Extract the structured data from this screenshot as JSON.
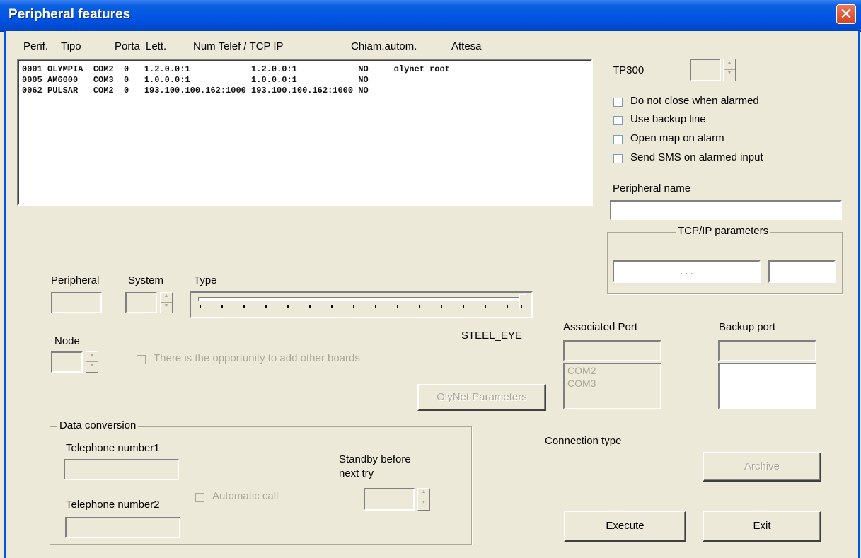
{
  "window": {
    "title": "Peripheral features",
    "close_icon": "close-icon"
  },
  "list": {
    "headers": [
      "Perif.",
      "Tipo",
      "Porta",
      "Lett.",
      "Num Telef / TCP IP",
      "Chiam.autom.",
      "Attesa"
    ],
    "rows": [
      "0001 OLYMPIA  COM2  0   1.2.0.0:1            1.2.0.0:1            NO     olynet root",
      "0005 AM6000   COM3  0   1.0.0.0:1            1.0.0.0:1            NO",
      "0062 PULSAR   COM2  0   193.100.100.162:1000 193.100.100.162:1000 NO"
    ]
  },
  "tp300": {
    "label": "TP300",
    "value": ""
  },
  "options": {
    "do_not_close": "Do not close when alarmed",
    "backup_line": "Use backup line",
    "open_map": "Open map on alarm",
    "send_sms": "Send SMS on alarmed input"
  },
  "peripheral_name": {
    "label": "Peripheral name",
    "value": ""
  },
  "tcpip": {
    "group_label": "TCP/IP parameters",
    "ip_dots": ".        .        .",
    "port": ""
  },
  "peripheral": {
    "label": "Peripheral",
    "value": ""
  },
  "system": {
    "label": "System",
    "value": ""
  },
  "type": {
    "label": "Type",
    "value_label": "STEEL_EYE",
    "slider_fraction": 1.0
  },
  "node": {
    "label": "Node",
    "value": ""
  },
  "add_boards": {
    "label": "There is the opportunity to add other boards"
  },
  "associated_port": {
    "label": "Associated Port",
    "value": "",
    "items": [
      "COM2",
      "COM3"
    ]
  },
  "backup_port": {
    "label": "Backup port",
    "value": ""
  },
  "olynet_button": "OlyNet Parameters",
  "data_conversion": {
    "group_label": "Data conversion",
    "tel1_label": "Telephone number1",
    "tel1_value": "",
    "tel2_label": "Telephone number2",
    "tel2_value": "",
    "automatic_call": "Automatic call",
    "standby_label_1": "Standby before",
    "standby_label_2": "next try",
    "standby_value": ""
  },
  "connection_type": {
    "label": "Connection type"
  },
  "archive_button": "Archive",
  "execute_button": "Execute",
  "exit_button": "Exit"
}
